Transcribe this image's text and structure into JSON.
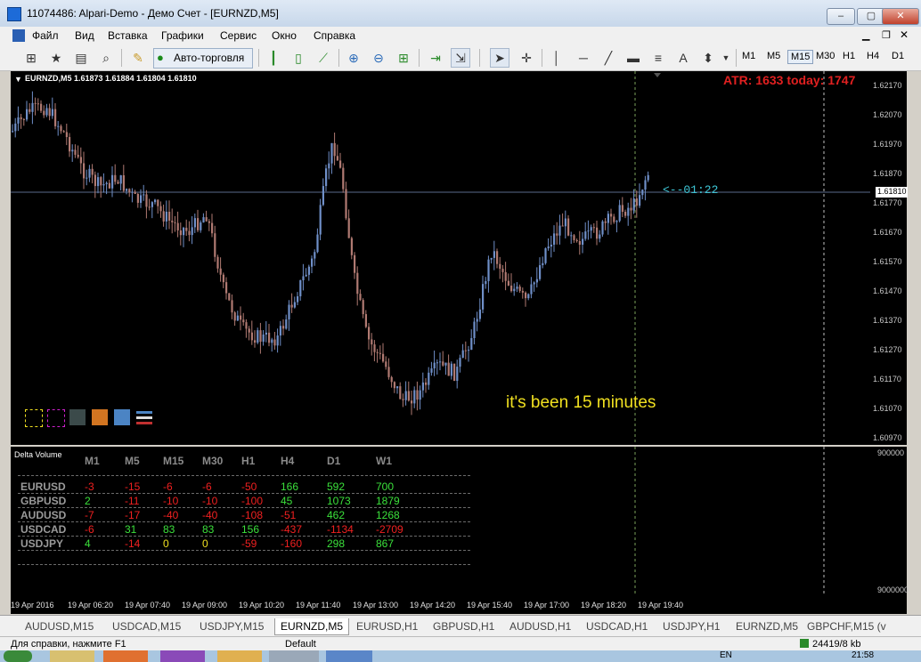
{
  "window": {
    "title": "11074486: Alpari-Demo - Демо Счет - [EURNZD,M5]",
    "buttons": [
      "–",
      "▢",
      "✕"
    ]
  },
  "menu": [
    "Файл",
    "Вид",
    "Вставка",
    "Графики",
    "Сервис",
    "Окно",
    "Справка"
  ],
  "toolbar": {
    "autotrading_label": "Авто-торговля",
    "timeframes": [
      "M1",
      "M5",
      "M15",
      "M30",
      "H1",
      "H4",
      "D1"
    ],
    "active_timeframe": "M15",
    "text_tool": "A"
  },
  "chart": {
    "header": "EURNZD,M5  1.61873 1.61884 1.61804 1.61810",
    "atr_text": "ATR: 1633  today: 1747",
    "timer_text": "<--01:22",
    "annotation": "it's been 15 minutes",
    "current_price": "1.61810",
    "price_labels": [
      "1.62170",
      "1.62070",
      "1.61970",
      "1.61870",
      "1.61770",
      "1.61670",
      "1.61570",
      "1.61470",
      "1.61370",
      "1.61270",
      "1.61170",
      "1.61070",
      "1.60970"
    ],
    "bull_color": "#6f8fc8",
    "bear_color": "#b07a72",
    "swatch_colors": [
      "#000000",
      "#000000",
      "#3b4a4a",
      "#d27521",
      "#4b84c4",
      "#c03030"
    ]
  },
  "indicator": {
    "title": "Delta Volume",
    "columns": [
      "M1",
      "M5",
      "M15",
      "M30",
      "H1",
      "H4",
      "D1",
      "W1"
    ],
    "rows": [
      {
        "symbol": "EURUSD",
        "values": [
          "-3",
          "-15",
          "-6",
          "-6",
          "-50",
          "166",
          "592",
          "700"
        ]
      },
      {
        "symbol": "GBPUSD",
        "values": [
          "2",
          "-11",
          "-10",
          "-10",
          "-100",
          "45",
          "1073",
          "1879"
        ]
      },
      {
        "symbol": "AUDUSD",
        "values": [
          "-7",
          "-17",
          "-40",
          "-40",
          "-108",
          "-51",
          "462",
          "1268"
        ]
      },
      {
        "symbol": "USDCAD",
        "values": [
          "-6",
          "31",
          "83",
          "83",
          "156",
          "-437",
          "-1134",
          "-2709"
        ]
      },
      {
        "symbol": "USDJPY",
        "values": [
          "4",
          "-14",
          "0",
          "0",
          "-59",
          "-160",
          "298",
          "867"
        ]
      }
    ],
    "axis_top": "900000",
    "axis_bottom": "9000000"
  },
  "time_axis": [
    "19 Apr 2016",
    "19 Apr 06:20",
    "19 Apr 07:40",
    "19 Apr 09:00",
    "19 Apr 10:20",
    "19 Apr 11:40",
    "19 Apr 13:00",
    "19 Apr 14:20",
    "19 Apr 15:40",
    "19 Apr 17:00",
    "19 Apr 18:20",
    "19 Apr 19:40"
  ],
  "tabs": [
    "AUDUSD,M15",
    "USDCAD,M15",
    "USDJPY,M15",
    "EURNZD,M5",
    "EURUSD,H1",
    "GBPUSD,H1",
    "AUDUSD,H1",
    "USDCAD,H1",
    "USDJPY,H1",
    "EURNZD,M5",
    "GBPCHF,M15 (v"
  ],
  "active_tab": 3,
  "status": {
    "help": "Для справки, нажмите F1",
    "profile": "Default",
    "traffic": "24419/8 kb"
  },
  "taskbar": {
    "lang": "EN",
    "clock": "21:58"
  }
}
